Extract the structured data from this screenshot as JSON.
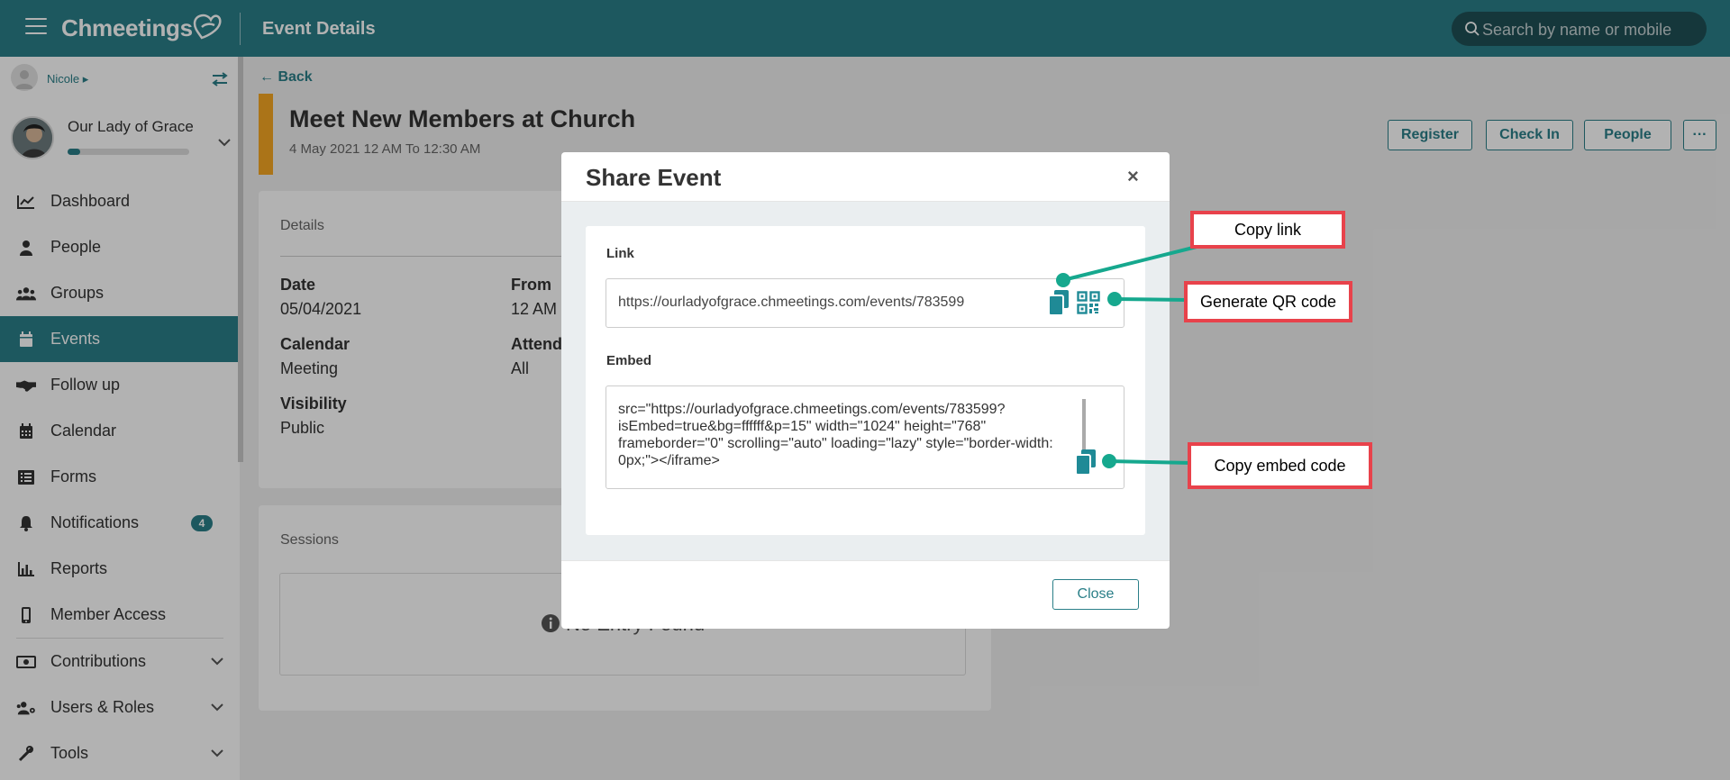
{
  "app": {
    "brand": "Chmeetings",
    "page_title": "Event Details"
  },
  "search": {
    "placeholder": "Search by name or mobile"
  },
  "user": {
    "name": "Nicole"
  },
  "org": {
    "name": "Our Lady of Grace",
    "progress": 0.1
  },
  "nav": [
    {
      "label": "Dashboard",
      "icon": "chart-line-icon"
    },
    {
      "label": "People",
      "icon": "person-icon"
    },
    {
      "label": "Groups",
      "icon": "users-icon"
    },
    {
      "label": "Events",
      "icon": "calendar-icon",
      "active": true
    },
    {
      "label": "Follow up",
      "icon": "handshake-icon"
    },
    {
      "label": "Calendar",
      "icon": "calendar-grid-icon"
    },
    {
      "label": "Forms",
      "icon": "form-list-icon"
    },
    {
      "label": "Notifications",
      "icon": "bell-icon",
      "badge": "4"
    },
    {
      "label": "Reports",
      "icon": "bar-chart-icon"
    },
    {
      "label": "Member Access",
      "icon": "mobile-icon"
    },
    {
      "label": "Contributions",
      "icon": "money-icon",
      "expandable": true
    },
    {
      "label": "Users & Roles",
      "icon": "users-cog-icon",
      "expandable": true
    },
    {
      "label": "Tools",
      "icon": "tools-icon",
      "expandable": true
    }
  ],
  "event": {
    "back_label": "Back",
    "title": "Meet New Members at Church",
    "date_range": "4 May 2021 12 AM To 12:30 AM",
    "color": "#f5a623",
    "actions": {
      "register": "Register",
      "checkin": "Check In",
      "people": "People",
      "more": "···"
    }
  },
  "details": {
    "heading": "Details",
    "date_label": "Date",
    "date_value": "05/04/2021",
    "from_label": "From",
    "from_value": "12 AM",
    "calendar_label": "Calendar",
    "calendar_value": "Meeting",
    "attend_label": "Attend",
    "attend_value": "All",
    "visibility_label": "Visibility",
    "visibility_value": "Public"
  },
  "sessions": {
    "heading": "Sessions",
    "empty_text": "No Entry Found"
  },
  "modal": {
    "title": "Share Event",
    "close_x": "×",
    "link_label": "Link",
    "link_value": "https://ourladyofgrace.chmeetings.com/events/783599",
    "embed_label": "Embed",
    "embed_value": "src=\"https://ourladyofgrace.chmeetings.com/events/783599?isEmbed=true&bg=ffffff&p=15\" width=\"1024\" height=\"768\" frameborder=\"0\" scrolling=\"auto\" loading=\"lazy\" style=\"border-width: 0px;\"></iframe>",
    "close_button": "Close"
  },
  "callouts": {
    "copy_link": "Copy link",
    "generate_qr": "Generate QR code",
    "copy_embed": "Copy embed code"
  },
  "colors": {
    "brand": "#2a7f88",
    "callout_border": "#e8424b",
    "connector": "#16a88e"
  }
}
